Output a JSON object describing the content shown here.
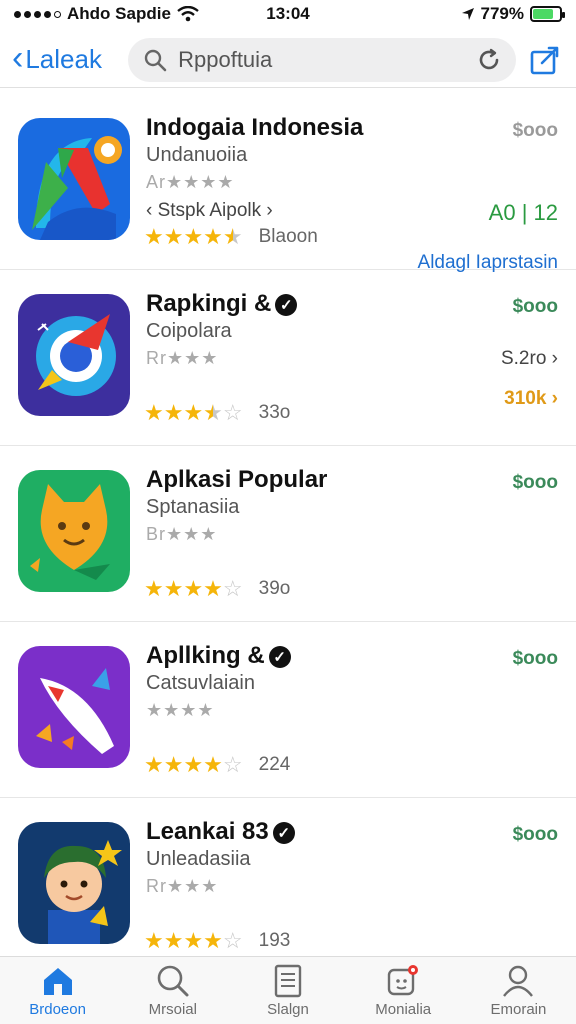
{
  "status_bar": {
    "carrier": "Ahdo Sapdie",
    "time": "13:04",
    "battery": "779%",
    "battery_level": 0.78
  },
  "nav": {
    "back_label": "Laleak",
    "search_value": "Rppoftuia"
  },
  "apps": [
    {
      "name": "Indogaia Indonesia",
      "subtitle": "Undanuoiia",
      "small_stars": "Ar★★★★",
      "extra": "‹ Stspk Aipolk ›",
      "rating": 4.5,
      "rating_count": "Blaoon",
      "price": "$ooo",
      "price_muted": true,
      "right_middle": "A0 | 12",
      "right_bottom": "Aldagl Iaprstasin",
      "right_bottom_color": "#1f6fd0"
    },
    {
      "name": "Rapkingi &",
      "verified": true,
      "subtitle": "Coipolara",
      "small_stars": "Rr★★★",
      "rating": 3.5,
      "rating_count": "33o",
      "price": "$ooo",
      "right_middle": "S.2ro ›",
      "right_bottom": "310k ›",
      "right_bottom_color": "#e09a18"
    },
    {
      "name": "Aplkasi Popular",
      "subtitle": "Sptanasiia",
      "small_stars": "Br★★★",
      "rating": 4,
      "rating_count": "39o",
      "price": "$ooo"
    },
    {
      "name": "Apllking &",
      "verified": true,
      "subtitle": "Catsuvlaiain",
      "small_stars": "★★★★",
      "rating": 4,
      "rating_count": "224",
      "price": "$ooo"
    },
    {
      "name": "Leankai 83",
      "verified": true,
      "subtitle": "Unleadasiia",
      "small_stars": "Rr★★★",
      "rating": 4,
      "rating_count": "193",
      "price": "$ooo"
    }
  ],
  "tabs": [
    {
      "label": "Brdoeon",
      "icon": "home-icon",
      "active": true
    },
    {
      "label": "Mrsoial",
      "icon": "search-icon",
      "active": false
    },
    {
      "label": "Slalgn",
      "icon": "document-icon",
      "active": false
    },
    {
      "label": "Monialia",
      "icon": "notification-icon",
      "active": false
    },
    {
      "label": "Emorain",
      "icon": "profile-icon",
      "active": false
    }
  ],
  "colors": {
    "accent": "#1f7ae0",
    "star": "#f5b50a",
    "price": "#3b8a5a"
  }
}
